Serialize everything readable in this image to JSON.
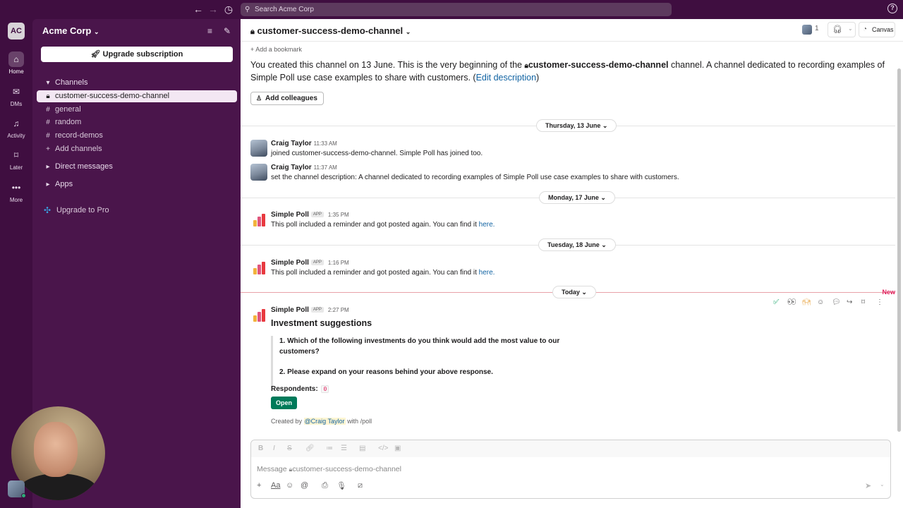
{
  "topbar": {
    "search_placeholder": "Search Acme Corp"
  },
  "rail": {
    "workspace_initials": "AC",
    "items": [
      {
        "label": "Home",
        "icon": "home-icon"
      },
      {
        "label": "DMs",
        "icon": "dm-icon"
      },
      {
        "label": "Activity",
        "icon": "bell-icon"
      },
      {
        "label": "Later",
        "icon": "bookmark-icon"
      },
      {
        "label": "More",
        "icon": "more-icon"
      }
    ]
  },
  "sidebar": {
    "workspace_name": "Acme Corp",
    "upgrade_button": "Upgrade subscription",
    "channels_section": "Channels",
    "channels": [
      {
        "name": "customer-success-demo-channel",
        "private": true,
        "active": true
      },
      {
        "name": "general"
      },
      {
        "name": "random"
      },
      {
        "name": "record-demos"
      }
    ],
    "add_channels": "Add channels",
    "direct_messages": "Direct messages",
    "apps": "Apps",
    "upgrade_pro": "Upgrade to Pro"
  },
  "channel": {
    "name": "customer-success-demo-channel",
    "member_count": "1",
    "canvas": "Canvas",
    "add_bookmark": "Add a bookmark",
    "intro_prefix": "You created this channel on 13 June. This is the very beginning of the",
    "intro_suffix": "channel. A channel dedicated to recording examples of Simple Poll use case examples to share with customers. (",
    "edit_description": "Edit description",
    "intro_close": ")",
    "add_colleagues": "Add colleagues"
  },
  "dates": {
    "d1": "Thursday, 13 June",
    "d2": "Monday, 17 June",
    "d3": "Tuesday, 18 June",
    "d4": "Today",
    "new_label": "New"
  },
  "messages": [
    {
      "author": "Craig Taylor",
      "time": "11:33 AM",
      "text": "joined customer-success-demo-channel. Simple Poll has joined too."
    },
    {
      "author": "Craig Taylor",
      "time": "11:37 AM",
      "text": "set the channel description: A channel dedicated to recording examples of Simple Poll use case examples to share with customers."
    },
    {
      "author": "Simple Poll",
      "badge": "APP",
      "time": "1:35 PM",
      "text": "This poll included a reminder and got posted again. You can find it",
      "link": "here."
    },
    {
      "author": "Simple Poll",
      "badge": "APP",
      "time": "1:16 PM",
      "text": "This poll included a reminder and got posted again. You can find it",
      "link": "here."
    },
    {
      "author": "Simple Poll",
      "badge": "APP",
      "time": "2:27 PM"
    }
  ],
  "poll": {
    "title": "Investment suggestions",
    "q1": "1. Which of the following investments do you think would add the most value to our customers?",
    "q2": "2. Please expand on your reasons behind your above response.",
    "respondents_label": "Respondents:",
    "respondents_count": "0",
    "open_button": "Open",
    "created_by": "Created by",
    "creator": "@Craig Taylor",
    "created_with": "with /poll"
  },
  "composer": {
    "placeholder": "Message",
    "channel": "customer-success-demo-channel"
  },
  "colors": {
    "aubergine": "#3f0e40",
    "sidebar": "#4a154b",
    "link": "#1264a3",
    "green": "#007a5a",
    "new": "#e01e5a"
  }
}
